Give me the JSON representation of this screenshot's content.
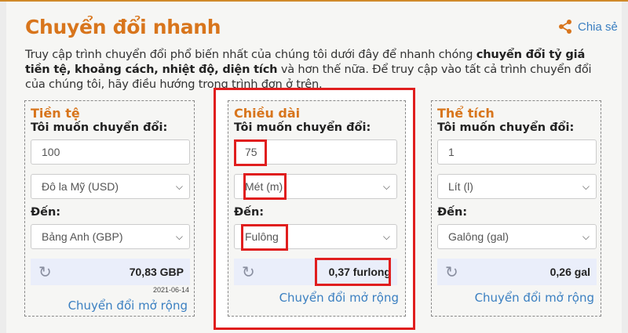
{
  "header": {
    "title": "Chuyển đổi nhanh",
    "share_label": "Chia sẻ"
  },
  "intro": {
    "part1": "Truy cập trình chuyển đổi phổ biến nhất của chúng tôi dưới đây để nhanh chóng ",
    "bold": "chuyển đổi tỷ giá tiền tệ, khoảng cách, nhiệt độ, diện tích",
    "part2": " và hơn thế nữa. Để truy cập vào tất cả trình chuyển đổi của chúng tôi, hãy điều hướng trong trình đơn ở trên."
  },
  "cards": {
    "currency": {
      "title": "Tiền tệ",
      "from_label": "Tôi muốn chuyển đổi:",
      "amount": "100",
      "from_unit": "Đô la Mỹ (USD)",
      "to_label": "Đến:",
      "to_unit": "Bảng Anh (GBP)",
      "result": "70,83 GBP",
      "date": "2021-06-14",
      "more": "Chuyển đổi mở rộng"
    },
    "length": {
      "title": "Chiều dài",
      "from_label": "Tôi muốn chuyển đổi:",
      "amount": "75",
      "from_unit": "Mét (m)",
      "to_label": "Đến:",
      "to_unit": "Fulông",
      "result": "0,37 furlong",
      "more": "Chuyển đổi mở rộng"
    },
    "volume": {
      "title": "Thể tích",
      "from_label": "Tôi muốn chuyển đổi:",
      "amount": "1",
      "from_unit": "Lít (l)",
      "to_label": "Đến:",
      "to_unit": "Galông (gal)",
      "result": "0,26 gal",
      "more": "Chuyển đổi mở rộng"
    }
  },
  "icons": {
    "share": "share-icon",
    "refresh": "refresh-icon",
    "chevron": "chevron-down-icon"
  },
  "colors": {
    "accent": "#d8751c",
    "link": "#3a7fc1",
    "highlight": "#e01e1e",
    "result_bg": "#eaeefa"
  }
}
